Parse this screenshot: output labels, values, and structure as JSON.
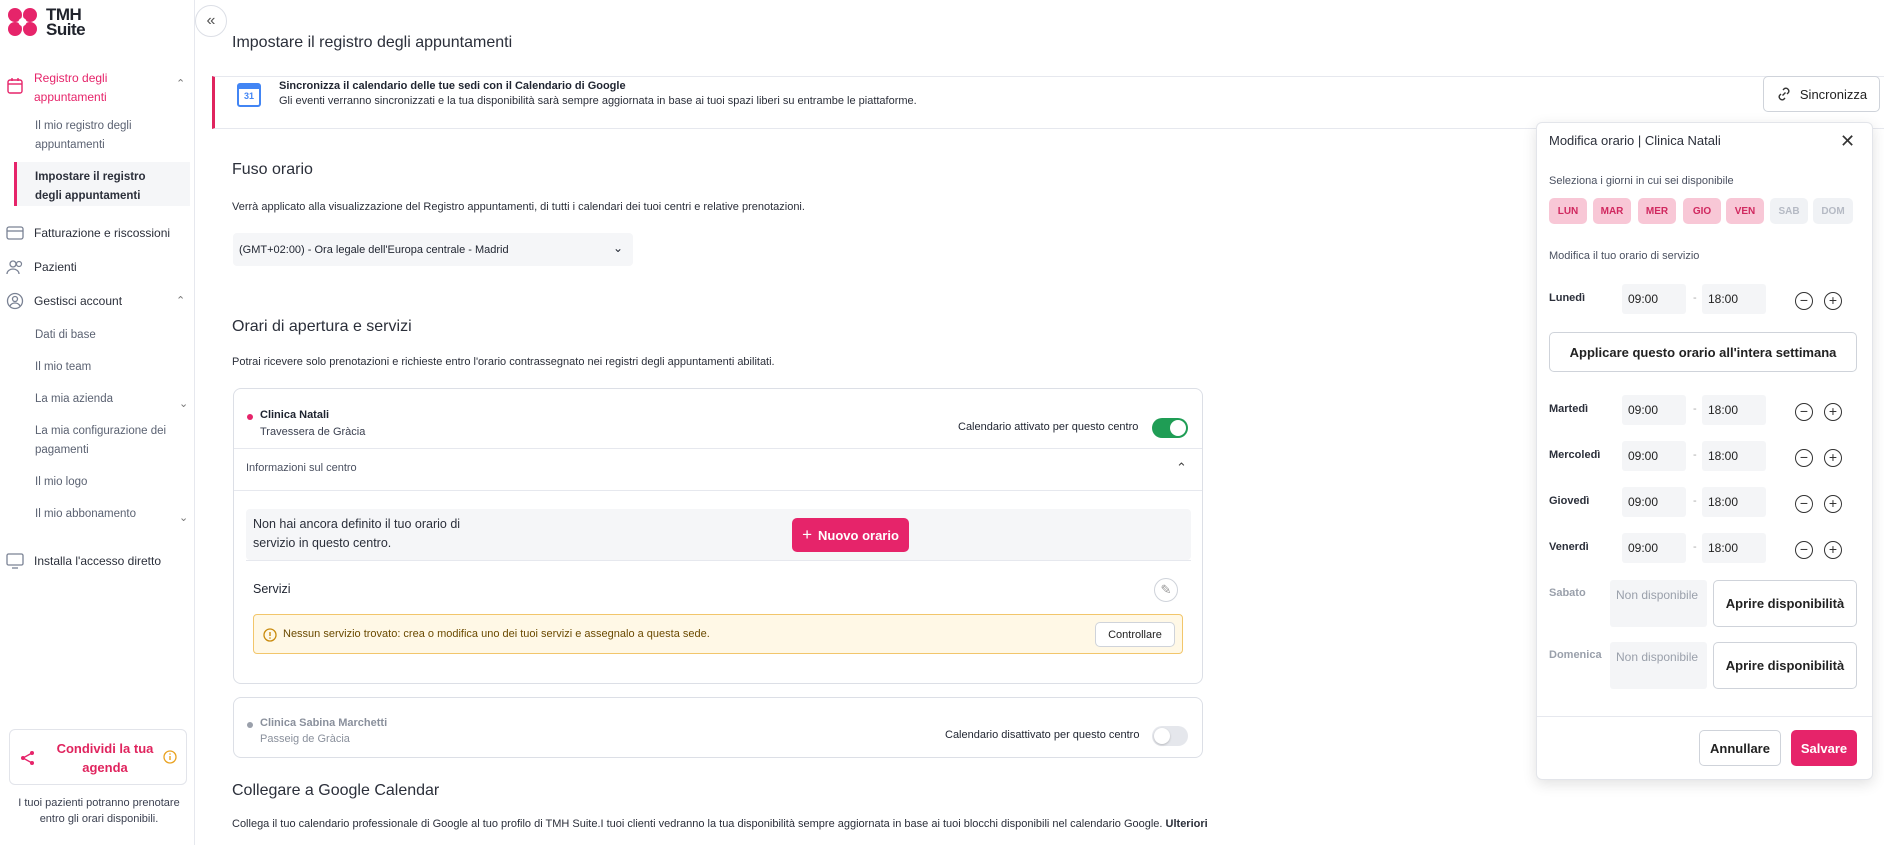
{
  "logo": {
    "line1": "TMH",
    "line2": "Suite"
  },
  "sidebar": {
    "registro": "Registro degli appuntamenti",
    "registro_sub": [
      "Il mio registro degli appuntamenti",
      "Impostare il registro degli appuntamenti"
    ],
    "fatturazione": "Fatturazione e riscossioni",
    "pazienti": "Pazienti",
    "gestisci": "Gestisci account",
    "gestisci_sub": [
      "Dati di base",
      "Il mio team",
      "La mia azienda",
      "La mia configurazione dei pagamenti",
      "Il mio logo",
      "Il mio abbonamento"
    ],
    "installa": "Installa l'accesso diretto",
    "share_title": "Condividi la tua agenda",
    "share_note": "I tuoi pazienti potranno prenotare entro gli orari disponibili."
  },
  "page_title": "Impostare il registro degli appuntamenti",
  "google_banner": {
    "icon_text": "31",
    "title": "Sincronizza il calendario delle tue sedi con il Calendario di Google",
    "text": "Gli eventi verranno sincronizzati e la tua disponibilità sarà sempre aggiornata in base ai tuoi spazi liberi su entrambe le piattaforme.",
    "button": "Sincronizza"
  },
  "timezone": {
    "heading": "Fuso orario",
    "desc": "Verrà applicato alla visualizzazione del Registro appuntamenti, di tutti i calendari dei tuoi centri e relative prenotazioni.",
    "selected": "(GMT+02:00) - Ora legale dell'Europa centrale - Madrid"
  },
  "hours": {
    "heading": "Orari di apertura e servizi",
    "desc": "Potrai ricevere solo prenotazioni e richieste entro l'orario contrassegnato nei registri degli appuntamenti abilitati."
  },
  "center1": {
    "name": "Clinica Natali",
    "address": "Travessera de Gràcia",
    "toggle_label": "Calendario attivato per questo centro",
    "info_label": "Informazioni sul centro",
    "empty_text": "Non hai ancora definito il tuo orario di servizio in questo centro.",
    "new_button": "Nuovo orario",
    "services_label": "Servizi",
    "warning": "Nessun servizio trovato: crea o modifica uno dei tuoi servizi e assegnalo a questa sede.",
    "check_button": "Controllare"
  },
  "center2": {
    "name": "Clinica Sabina Marchetti",
    "address": "Passeig de Gràcia",
    "toggle_label": "Calendario disattivato per questo centro"
  },
  "google_connect": {
    "heading": "Collegare a Google Calendar",
    "text": "Collega il tuo calendario professionale di Google al tuo profilo di TMH Suite.I tuoi clienti vedranno la tua disponibilità sempre aggiornata in base ai tuoi blocchi disponibili nel calendario Google.",
    "more": "Ulteriori"
  },
  "panel": {
    "title": "Modifica orario",
    "separator": "|",
    "clinic": "Clinica Natali",
    "days_label": "Seleziona i giorni in cui sei disponibile",
    "days": [
      "LUN",
      "MAR",
      "MER",
      "GIO",
      "VEN",
      "SAB",
      "DOM"
    ],
    "hours_label": "Modifica il tuo orario di servizio",
    "rows": [
      {
        "day": "Lunedì",
        "from": "09:00",
        "to": "18:00"
      },
      {
        "day": "Martedì",
        "from": "09:00",
        "to": "18:00"
      },
      {
        "day": "Mercoledì",
        "from": "09:00",
        "to": "18:00"
      },
      {
        "day": "Giovedì",
        "from": "09:00",
        "to": "18:00"
      },
      {
        "day": "Venerdì",
        "from": "09:00",
        "to": "18:00"
      }
    ],
    "dash": "-",
    "apply_week": "Applicare questo orario all'intera settimana",
    "sabato": "Sabato",
    "domenica": "Domenica",
    "not_available": "Non disponibile",
    "open_availability": "Aprire disponibilità",
    "cancel": "Annullare",
    "save": "Salvare"
  },
  "colors": {
    "accent": "#e6246a",
    "toggle_on": "#1f9d55",
    "day_on_bg": "#f8c7d6"
  }
}
